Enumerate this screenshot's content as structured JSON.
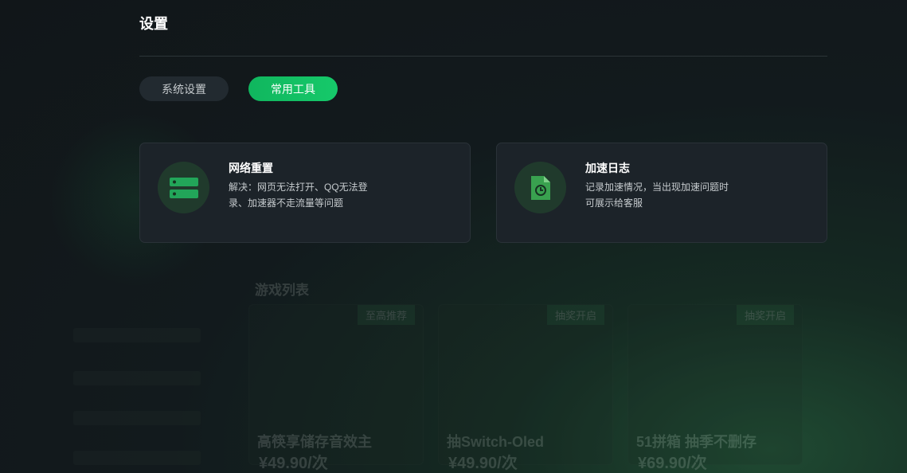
{
  "header": {
    "title": "设置"
  },
  "tabs": [
    {
      "label": "系统设置",
      "active": false
    },
    {
      "label": "常用工具",
      "active": true
    }
  ],
  "cards": [
    {
      "title": "网络重置",
      "description": "解决：网页无法打开、QQ无法登录、加速器不走流量等问题",
      "icon": "server-icon"
    },
    {
      "title": "加速日志",
      "description": "记录加速情况，当出现加速问题时可展示给客服",
      "icon": "log-file-clock-icon"
    }
  ],
  "background": {
    "sections": [
      "游戏列表"
    ],
    "games": [
      {
        "name": "高筷享储存音效主",
        "price": "¥49.90/次",
        "badge": "至高推荐"
      },
      {
        "name": "抽Switch-Oled",
        "price": "¥49.90/次",
        "badge": "抽奖开启"
      },
      {
        "name": "51拼箱 抽季不删存",
        "price": "¥69.90/次",
        "badge": "抽奖开启"
      }
    ]
  },
  "colors": {
    "accent": "#16c96a",
    "card_bg": "#1c2329",
    "page_bg": "#121a1d"
  }
}
